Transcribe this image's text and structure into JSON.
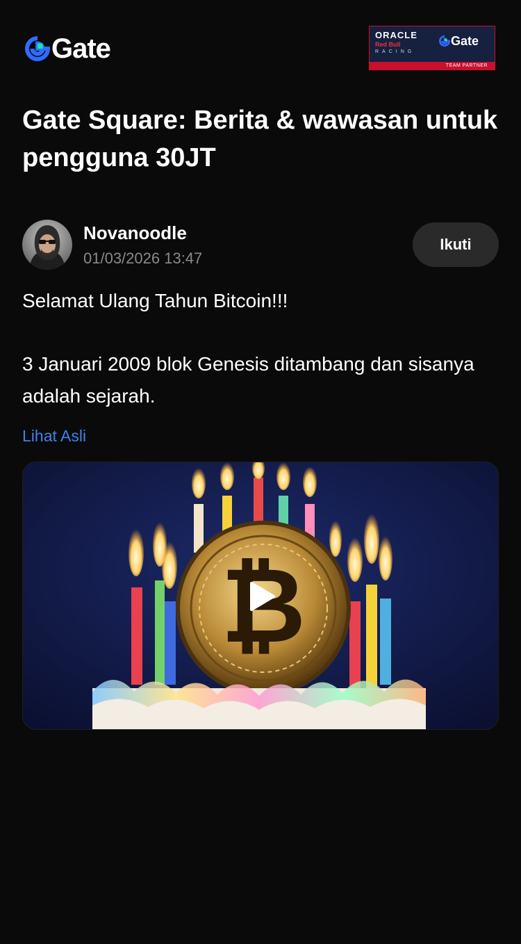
{
  "header": {
    "logo_text": "Gate",
    "partner_badge": {
      "line1": "ORACLE",
      "line2": "Red Bull",
      "line3": "RACING",
      "brand": "Gate",
      "strip": "TEAM PARTNER"
    }
  },
  "page": {
    "title": "Gate Square: Berita & wawasan untuk pengguna 30JT"
  },
  "post": {
    "author": "Novanoodle",
    "timestamp": "01/03/2026 13:47",
    "follow_label": "Ikuti",
    "paragraph1": "Selamat Ulang Tahun Bitcoin!!!",
    "paragraph2": "3 Januari 2009 blok Genesis ditambang dan sisanya adalah sejarah.",
    "translate_link": "Lihat Asli"
  },
  "colors": {
    "background": "#0a0a0a",
    "accent_blue": "#3c82f0",
    "logo_green": "#17e5a5",
    "muted_text": "#8a8a8a",
    "follow_bg": "#2a2a2a"
  },
  "icons": {
    "logo": "gate-logo-icon",
    "play": "play-icon"
  }
}
